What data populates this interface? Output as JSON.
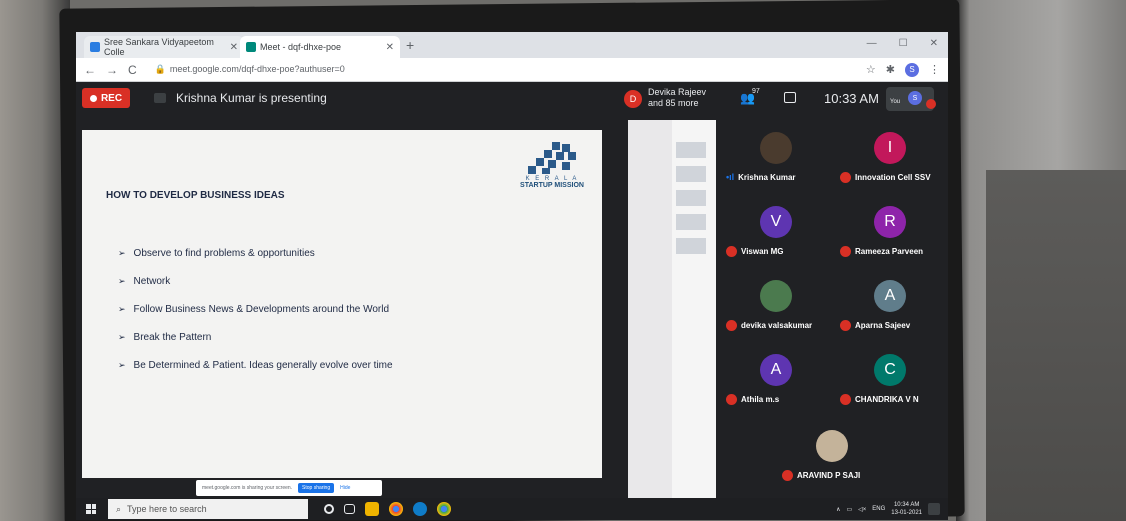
{
  "browser": {
    "tabs": [
      {
        "label": "Sree Sankara Vidyapeetom Colle",
        "favicon_color": "#2a7de1"
      },
      {
        "label": "Meet - dqf-dhxe-poe",
        "favicon_color": "#00897b"
      }
    ],
    "url": "meet.google.com/dqf-dhxe-poe?authuser=0",
    "profile_initial": "S"
  },
  "meet": {
    "rec_label": "REC",
    "presenting_text": "Krishna Kumar is presenting",
    "pinned_initial": "D",
    "pinned_name": "Devika Rajeev",
    "pinned_more": "and 85 more",
    "people_count": "97",
    "time": "10:33 AM",
    "self_label": "You",
    "self_initial": "S"
  },
  "slide": {
    "logo_line1": "K E R A L A",
    "logo_line2": "STARTUP MISSION",
    "title": "HOW TO DEVELOP BUSINESS IDEAS",
    "bullets": [
      "Observe to find problems & opportunities",
      "Network",
      "Follow Business News & Developments around the World",
      "Break the Pattern",
      "Be Determined & Patient. Ideas generally evolve over time"
    ]
  },
  "share_bar": {
    "text": "meet.google.com is sharing your screen.",
    "stop": "Stop sharing",
    "hide": "Hide"
  },
  "participants": [
    {
      "name": "Krishna Kumar",
      "initial": "",
      "color": "#4a3b2e",
      "muted": false
    },
    {
      "name": "Innovation Cell SSV",
      "initial": "I",
      "color": "#c2185b",
      "muted": true
    },
    {
      "name": "Viswan MG",
      "initial": "V",
      "color": "#5e35b1",
      "muted": true
    },
    {
      "name": "Rameeza Parveen",
      "initial": "R",
      "color": "#8e24aa",
      "muted": true
    },
    {
      "name": "devika valsakumar",
      "initial": "",
      "color": "#4b7a4e",
      "muted": true
    },
    {
      "name": "Aparna Sajeev",
      "initial": "A",
      "color": "#607d8b",
      "muted": true
    },
    {
      "name": "Athila m.s",
      "initial": "A",
      "color": "#5e35b1",
      "muted": true
    },
    {
      "name": "CHANDRIKA V N",
      "initial": "C",
      "color": "#00796b",
      "muted": true
    },
    {
      "name": "ARAVIND P SAJI",
      "initial": "",
      "color": "#c4b39a",
      "muted": true
    }
  ],
  "taskbar": {
    "search_placeholder": "Type here to search",
    "lang": "ENG",
    "clock_time": "10:34 AM",
    "clock_date": "13-01-2021"
  }
}
